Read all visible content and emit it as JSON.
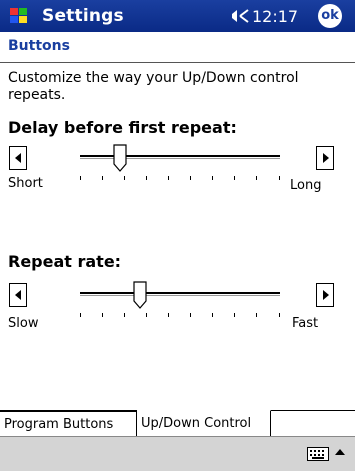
{
  "titlebar": {
    "app_title": "Settings",
    "clock": "12:17",
    "ok_label": "ok"
  },
  "page": {
    "title": "Buttons",
    "description": "Customize the way your Up/Down control repeats."
  },
  "delay_slider": {
    "label": "Delay before first repeat:",
    "min_label": "Short",
    "max_label": "Long",
    "level": 0.2
  },
  "rate_slider": {
    "label": "Repeat rate:",
    "min_label": "Slow",
    "max_label": "Fast",
    "level": 0.3
  },
  "tabs": [
    {
      "label": "Program Buttons",
      "active": false
    },
    {
      "label": "Up/Down Control",
      "active": true
    }
  ],
  "colors": {
    "titlebar": "#1a3fa0",
    "page_title": "#1a3fa0",
    "menubar": "#d4d4d4"
  },
  "icons": {
    "start": "windows-flag-icon",
    "speaker": "speaker-icon",
    "keyboard": "keyboard-icon",
    "sip": "up-arrow-icon"
  }
}
